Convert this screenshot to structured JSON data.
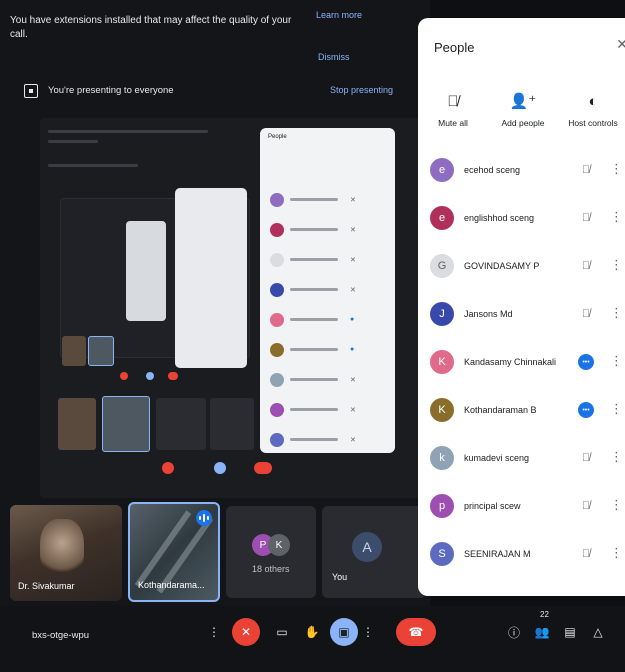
{
  "banner": {
    "message": "You have extensions installed that may affect the quality of your call.",
    "learn_more": "Learn more",
    "dismiss": "Dismiss"
  },
  "presenting": {
    "text": "You're presenting to everyone",
    "stop": "Stop presenting"
  },
  "tiles": [
    {
      "name": "Dr. Sivakumar",
      "kind": "camera"
    },
    {
      "name": "Kothandarama...",
      "kind": "camera",
      "speaking": true
    },
    {
      "name": "18 others",
      "kind": "others",
      "avatars": [
        "P",
        "K"
      ]
    },
    {
      "name": "You",
      "kind": "self",
      "avatar": "A"
    }
  ],
  "people_panel": {
    "title": "People",
    "actions": [
      {
        "label": "Mute all",
        "icon": "mic-off-icon"
      },
      {
        "label": "Add people",
        "icon": "person-add-icon"
      },
      {
        "label": "Host controls",
        "icon": "host-controls-icon"
      }
    ],
    "participants": [
      {
        "name": "ecehod sceng",
        "initial": "e",
        "color": "#8e6cc2",
        "mic": "muted"
      },
      {
        "name": "englishhod sceng",
        "initial": "e",
        "color": "#b0305c",
        "mic": "muted"
      },
      {
        "name": "GOVINDASAMY P",
        "initial": "G",
        "color": "#dadce0",
        "mic": "muted"
      },
      {
        "name": "Jansons Md",
        "initial": "J",
        "color": "#3949ab",
        "mic": "muted"
      },
      {
        "name": "Kandasamy Chinnakali",
        "initial": "K",
        "color": "#e06a8a",
        "mic": "live"
      },
      {
        "name": "Kothandaraman B",
        "initial": "K",
        "color": "#8a6d2b",
        "mic": "live"
      },
      {
        "name": "kumadevi sceng",
        "initial": "k",
        "color": "#8fa3b5",
        "mic": "muted"
      },
      {
        "name": "principal scew",
        "initial": "p",
        "color": "#9c4fb0",
        "mic": "muted"
      },
      {
        "name": "SEENIRAJAN M",
        "initial": "S",
        "color": "#5c6bc0",
        "mic": "muted"
      }
    ]
  },
  "controls": {
    "meeting_code": "bxs-otge-wpu",
    "people_count": "22",
    "accent": "#8ab4f8",
    "end_color": "#ea4335"
  }
}
